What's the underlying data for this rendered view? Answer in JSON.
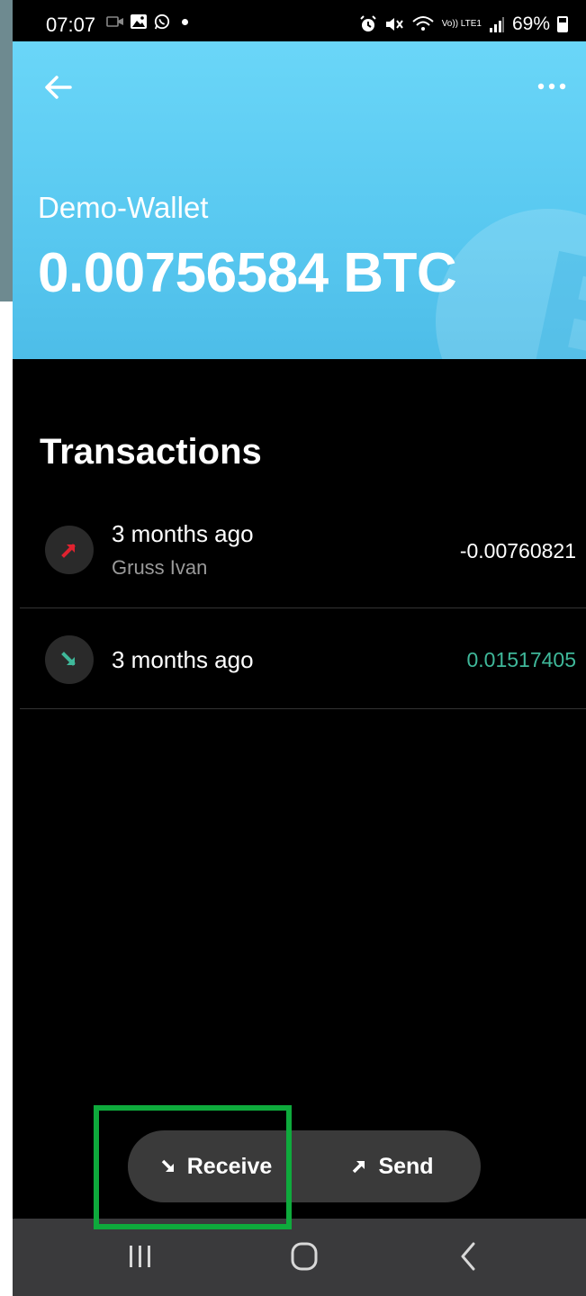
{
  "status_bar": {
    "time": "07:07",
    "battery_text": "69%",
    "signal_label": "Vo)) LTE1"
  },
  "header": {
    "wallet_name": "Demo-Wallet",
    "balance": "0.00756584 BTC",
    "accent_color": "#5fcff5"
  },
  "transactions": {
    "title": "Transactions",
    "items": [
      {
        "direction": "outgoing",
        "icon": "arrow-up-right-icon",
        "time": "3 months ago",
        "counterparty": "Gruss Ivan",
        "amount": "-0.00760821",
        "amount_color": "#ffffff",
        "icon_color": "#e0222f"
      },
      {
        "direction": "incoming",
        "icon": "arrow-down-right-icon",
        "time": "3 months ago",
        "counterparty": "",
        "amount": "0.01517405",
        "amount_color": "#3fb89a",
        "icon_color": "#3fb89a"
      }
    ]
  },
  "actions": {
    "receive_label": "Receive",
    "send_label": "Send",
    "highlight_color": "#0eaa3c"
  },
  "nav_bar": {
    "recents_icon": "recents-icon",
    "home_icon": "home-icon",
    "back_icon": "back-icon"
  }
}
